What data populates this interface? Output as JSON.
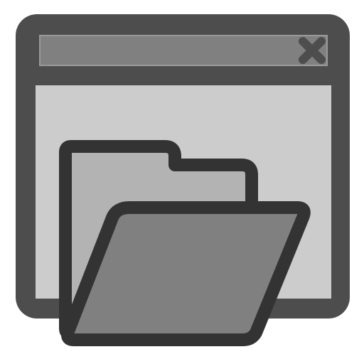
{
  "icon": {
    "name": "open-folder-in-window-icon",
    "window_icon": "application-window-icon",
    "close_icon": "close-x-icon",
    "folder_icon": "open-folder-icon"
  },
  "colors": {
    "window_frame": "#4d4d4d",
    "titlebar": "#808080",
    "window_body": "#cccccc",
    "folder_back": "#b3b3b3",
    "folder_front": "#808080",
    "outline": "#333333",
    "close_glyph": "#4d4d4d"
  }
}
